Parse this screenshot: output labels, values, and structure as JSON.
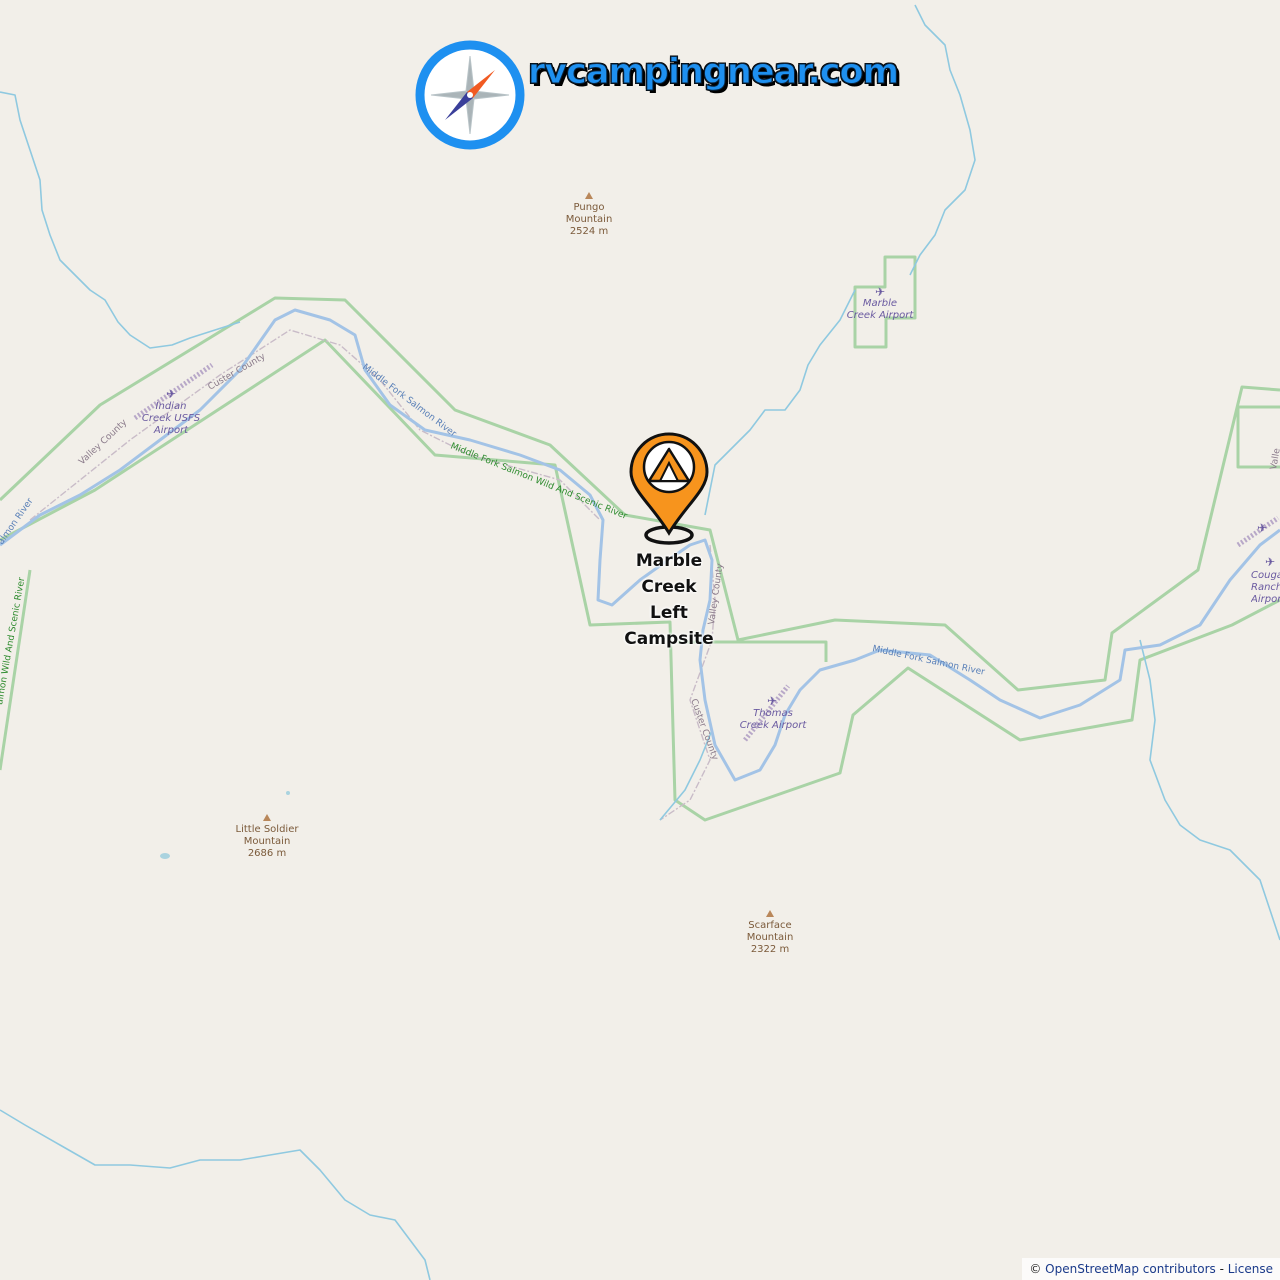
{
  "logo": {
    "text": "rvcampingnear.com",
    "icon": "compass-icon"
  },
  "marker": {
    "icon": "campsite-tent-icon",
    "label_lines": [
      "Marble",
      "Creek",
      "Left",
      "Campsite"
    ],
    "color": "#f7941d"
  },
  "peaks": [
    {
      "name_lines": [
        "Pungo",
        "Mountain"
      ],
      "elevation": "2524 m"
    },
    {
      "name_lines": [
        "Little Soldier",
        "Mountain"
      ],
      "elevation": "2686 m"
    },
    {
      "name_lines": [
        "Scarface",
        "Mountain"
      ],
      "elevation": "2322 m"
    }
  ],
  "airports": [
    {
      "name_lines": [
        "Marble",
        "Creek Airport"
      ]
    },
    {
      "name_lines": [
        "Indian",
        "Creek USFS",
        "Airport"
      ]
    },
    {
      "name_lines": [
        "Thomas",
        "Creek Airport"
      ]
    },
    {
      "name_lines": [
        "Couga",
        "Ranch",
        "Airpor"
      ]
    }
  ],
  "map_labels": {
    "custer_county_1": "Custer County",
    "valley_county_1": "Valley County",
    "custer_county_2": "Custer County",
    "valley_county_2": "Valley County",
    "river_1": "Middle Fork Salmon River",
    "river_2": "Middle Fork Salmon River",
    "river_3": "almon River",
    "wild_scenic_1": "Middle Fork Salmon Wild And Scenic River",
    "wild_scenic_2": "almon Wild And Scenic River",
    "edge_valley": "Valle"
  },
  "attribution": {
    "prefix": "© ",
    "osm": "OpenStreetMap contributors",
    "sep": " - ",
    "license": "License"
  },
  "colors": {
    "background": "#f2efe9",
    "water": "#8fc9e0",
    "river": "#a3c3e6",
    "boundary_green": "#a9d3a6",
    "county_line": "#c7b7c6",
    "peak": "#7b5a3a",
    "airport": "#6a5aa0"
  }
}
